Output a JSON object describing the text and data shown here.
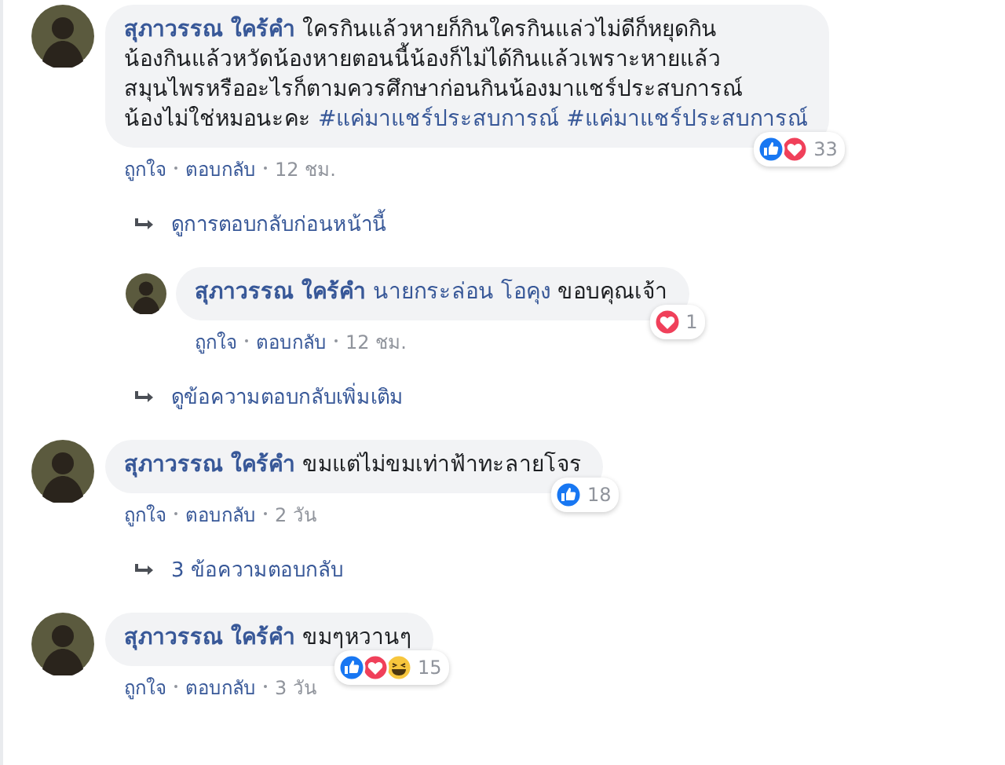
{
  "thread": [
    {
      "kind": "comment",
      "author": "สุภาวรรณ ใคร้คำ",
      "segments": [
        {
          "kind": "plain",
          "text": "ใครกินแล้วหายก็กินใครกินแล่วไม่ดีก็หยุดกิน\nน้องกินแล้วหวัดน้องหายตอนนี้น้องก็ไม่ได้กินแล้วเพราะหายแล้ว\nสมุนไพรหรืออะไรก็ตามควรศึกษาก่อนกินน้องมาแชร์ประสบการณ์\nน้องไม่ใช่หมอนะคะ "
        },
        {
          "kind": "tag",
          "text": "#แค่มาแชร์ประสบการณ์"
        },
        {
          "kind": "tag",
          "text": "#แค่มาแชร์ประสบการณ์"
        }
      ],
      "reactions": [
        {
          "kind": "like"
        },
        {
          "kind": "love"
        }
      ],
      "reaction_count": "33",
      "actions": [
        "ถูกใจ",
        "ตอบกลับ"
      ],
      "time": "12 ชม."
    },
    {
      "kind": "more",
      "text": "ดูการตอบกลับก่อนหน้านี้"
    },
    {
      "kind": "reply",
      "author": "สุภาวรรณ ใคร้คำ",
      "segments": [
        {
          "kind": "tag",
          "text": "นายกระล่อน โอคุง"
        },
        {
          "kind": "plain",
          "text": " ขอบคุณเจ้า"
        }
      ],
      "reactions": [
        {
          "kind": "love"
        }
      ],
      "reaction_count": "1",
      "actions": [
        "ถูกใจ",
        "ตอบกลับ"
      ],
      "time": "12 ชม."
    },
    {
      "kind": "more",
      "text": "ดูข้อความตอบกลับเพิ่มเติม"
    },
    {
      "kind": "comment",
      "author": "สุภาวรรณ ใคร้คำ",
      "segments": [
        {
          "kind": "plain",
          "text": "ขมแต่ไม่ขมเท่าฟ้าทะลายโจร"
        }
      ],
      "reactions": [
        {
          "kind": "like"
        }
      ],
      "reaction_count": "18",
      "actions": [
        "ถูกใจ",
        "ตอบกลับ"
      ],
      "time": "2 วัน"
    },
    {
      "kind": "more",
      "text": "3 ข้อความตอบกลับ"
    },
    {
      "kind": "comment",
      "author": "สุภาวรรณ ใคร้คำ",
      "segments": [
        {
          "kind": "plain",
          "text": "ขมๆหวานๆ"
        }
      ],
      "reactions": [
        {
          "kind": "like"
        },
        {
          "kind": "love"
        },
        {
          "kind": "haha"
        }
      ],
      "reaction_count": "15",
      "actions": [
        "ถูกใจ",
        "ตอบกลับ"
      ],
      "time": "3 วัน"
    }
  ]
}
